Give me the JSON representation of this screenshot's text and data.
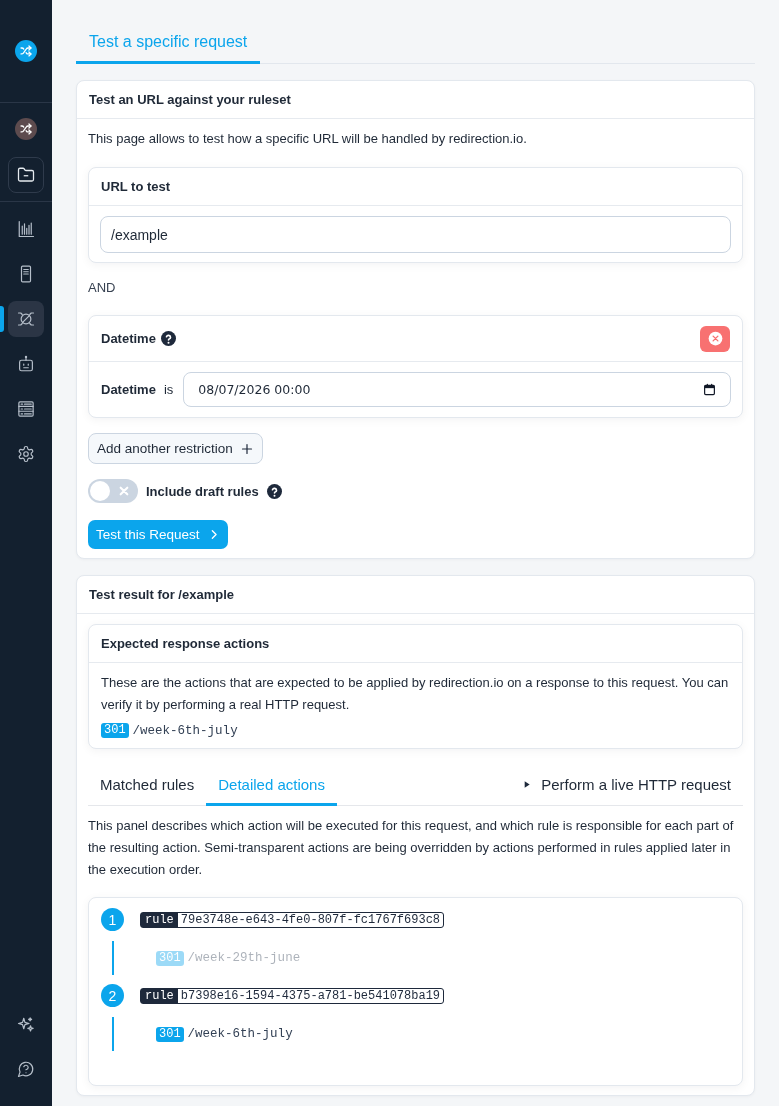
{
  "sidebar": {
    "nav_items": [
      {
        "selected": false
      },
      {
        "selected": false
      },
      {
        "selected": true
      },
      {
        "selected": false
      },
      {
        "selected": false
      },
      {
        "selected": false
      }
    ]
  },
  "page_tabs": [
    {
      "label": "Test a specific request",
      "selected": true
    }
  ],
  "test_card": {
    "title": "Test an URL against your ruleset",
    "description": "This page allows to test how a specific URL will be handled by redirection.io.",
    "url_panel": {
      "title": "URL to test",
      "value": "/example"
    },
    "connector": "AND",
    "restrictions": [
      {
        "title": "Datetime",
        "field_label": "Datetime",
        "operator": "is",
        "value": "08/07/2026 00:00"
      }
    ],
    "add_button": "Add another restriction",
    "draft_toggle": {
      "label": "Include draft rules",
      "on": false
    },
    "submit_button": "Test this Request"
  },
  "result_card": {
    "title": "Test result for /example",
    "expected": {
      "title": "Expected response actions",
      "description": "These are the actions that are expected to be applied by redirection.io on a response to this request. You can verify it by performing a real HTTP request.",
      "actions": [
        {
          "status": "301",
          "target": "/week-6th-july"
        }
      ]
    },
    "tabs": [
      {
        "label": "Matched rules",
        "selected": false
      },
      {
        "label": "Detailed actions",
        "selected": true
      }
    ],
    "live_request": {
      "label": "Perform a live HTTP request",
      "expanded": false
    },
    "description": "This panel describes which action will be executed for this request, and which rule is responsible for each part of the resulting action. Semi-transparent actions are being overridden by actions performed in rules applied later in the execution order.",
    "steps": [
      {
        "number": "1",
        "rule_tag": "rule",
        "rule_id": "79e3748e-e643-4fe0-807f-fc1767f693c8",
        "actions": [
          {
            "status": "301",
            "target": "/week-29th-june",
            "overridden": true
          }
        ]
      },
      {
        "number": "2",
        "rule_tag": "rule",
        "rule_id": "b7398e16-1594-4375-a781-be541078ba19",
        "actions": [
          {
            "status": "301",
            "target": "/week-6th-july",
            "overridden": false
          }
        ]
      }
    ]
  }
}
